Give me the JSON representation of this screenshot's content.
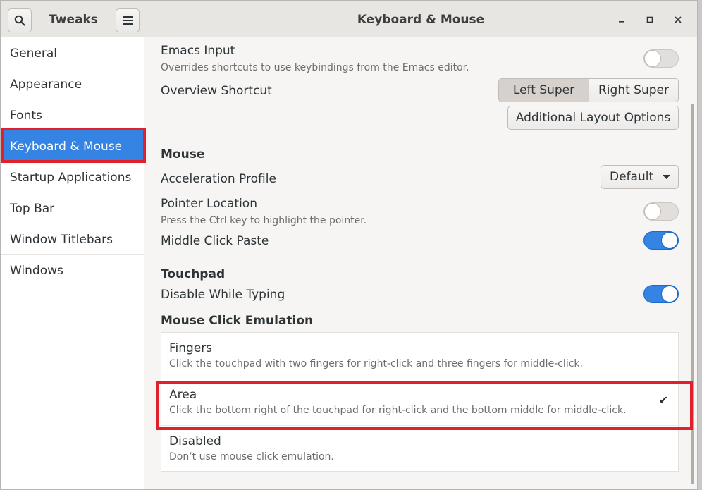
{
  "header": {
    "app_title": "Tweaks",
    "page_title": "Keyboard & Mouse",
    "search_icon": "search-icon",
    "menu_icon": "hamburger-menu-icon",
    "minimize_glyph": "‒",
    "maximize_glyph": "▫",
    "close_glyph": "✕"
  },
  "sidebar": {
    "items": [
      {
        "label": "General"
      },
      {
        "label": "Appearance"
      },
      {
        "label": "Fonts"
      },
      {
        "label": "Keyboard & Mouse"
      },
      {
        "label": "Startup Applications"
      },
      {
        "label": "Top Bar"
      },
      {
        "label": "Window Titlebars"
      },
      {
        "label": "Windows"
      }
    ],
    "selected": "Keyboard & Mouse"
  },
  "keyboard": {
    "emacs_label": "Emacs Input",
    "emacs_sub": "Overrides shortcuts to use keybindings from the Emacs editor.",
    "emacs_on": false,
    "overview_label": "Overview Shortcut",
    "overview_left": "Left Super",
    "overview_right": "Right Super",
    "overview_selected": "Left Super",
    "additional_button": "Additional Layout Options"
  },
  "mouse": {
    "heading": "Mouse",
    "accel_label": "Acceleration Profile",
    "accel_value": "Default",
    "pointer_label": "Pointer Location",
    "pointer_sub": "Press the Ctrl key to highlight the pointer.",
    "pointer_on": false,
    "middle_label": "Middle Click Paste",
    "middle_on": true
  },
  "touchpad": {
    "heading": "Touchpad",
    "disable_typing_label": "Disable While Typing",
    "disable_typing_on": true,
    "emulation_heading": "Mouse Click Emulation",
    "options": [
      {
        "label": "Fingers",
        "desc": "Click the touchpad with two fingers for right-click and three fingers for middle-click.",
        "checked": false
      },
      {
        "label": "Area",
        "desc": "Click the bottom right of the touchpad for right-click and the bottom middle for middle-click.",
        "checked": true
      },
      {
        "label": "Disabled",
        "desc": "Don’t use mouse click emulation.",
        "checked": false
      }
    ],
    "check_glyph": "✔"
  },
  "colors": {
    "accent": "#3584e4",
    "highlight": "#e0202a"
  }
}
